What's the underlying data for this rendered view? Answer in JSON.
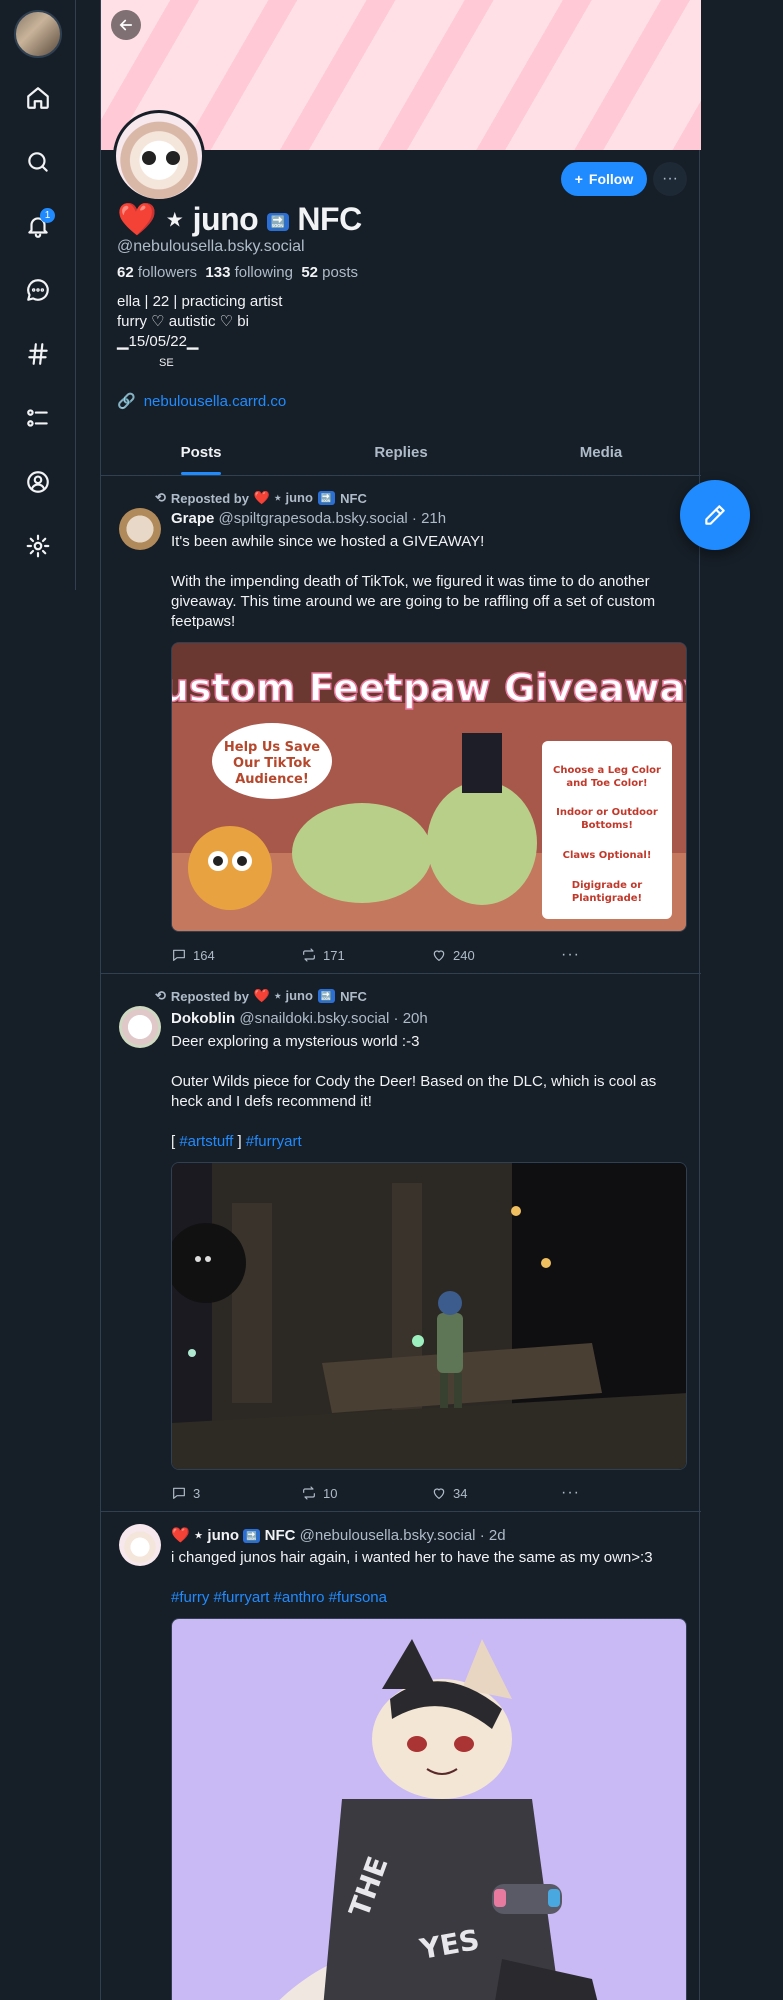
{
  "profile": {
    "display_name_prefix": "❤️ ⋆",
    "display_name_main": "juno",
    "soon_badge": "🔜",
    "display_name_suffix": "NFC",
    "handle": "@nebulousella.bsky.social",
    "followers_count": "62",
    "followers_label": "followers",
    "following_count": "133",
    "following_label": "following",
    "posts_count": "52",
    "posts_label": "posts",
    "bio": "ella | 22 | practicing artist\nfurry ♡ autistic ♡ bi\n▁15/05/22▁",
    "bio_small": "SE",
    "link": "nebulousella.carrd.co",
    "follow_label": "Follow",
    "more_label": "···"
  },
  "tabs": [
    "Posts",
    "Replies",
    "Media"
  ],
  "reposter": {
    "prefix": "Reposted by",
    "name": "❤️ ⋆ juno",
    "soon": "🔜",
    "suffix": "NFC"
  },
  "posts": [
    {
      "name": "Grape",
      "handle": "@spiltgrapesoda.bsky.social",
      "time": "· 21h",
      "paragraphs": [
        "It's been awhile since we hosted a GIVEAWAY!",
        "With the impending death of TikTok, we figured it was time to do another giveaway. This time around we are going to be raffling off a set of custom feetpaws!"
      ],
      "image": {
        "title": "Custom Feetpaw Giveaway!",
        "bubble": "Help Us Save Our TikTok Audience!",
        "card_lines": [
          "Choose a Leg Color and Toe Color!",
          "Indoor or Outdoor Bottoms!",
          "Claws Optional!",
          "Digigrade or Plantigrade!"
        ]
      },
      "replies": "164",
      "reposts": "171",
      "likes": "240"
    },
    {
      "name": "Dokoblin",
      "handle": "@snaildoki.bsky.social",
      "time": "· 20h",
      "paragraphs": [
        "Deer exploring a mysterious world :-3",
        "Outer Wilds piece for Cody the Deer! Based on the DLC, which is cool as heck and I defs recommend it!"
      ],
      "tag_open": "[",
      "tags": [
        "#artstuff",
        "#furryart"
      ],
      "tag_close": "]",
      "replies": "3",
      "reposts": "10",
      "likes": "34"
    },
    {
      "name_prefix": "❤️ ⋆ juno",
      "soon": "🔜",
      "name_suffix": "NFC",
      "handle": "@nebulousella.bsky.social",
      "time": "· 2d",
      "text": "i changed junos hair again, i wanted her to have the same as my own>:3",
      "tags": [
        "#furry",
        "#furryart",
        "#anthro",
        "#fursona"
      ],
      "image": {
        "hoodie_text": "THE YES"
      }
    }
  ],
  "colors": {
    "accent": "#208bfe",
    "background": "#161e27",
    "border": "#2e4052",
    "muted": "#aebbc9"
  }
}
